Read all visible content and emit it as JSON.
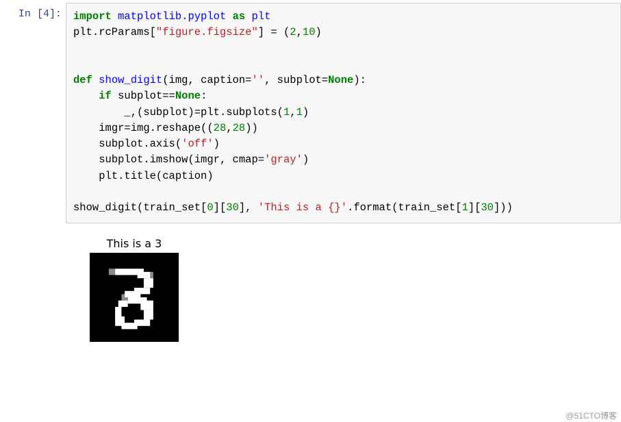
{
  "prompt": {
    "label": "In",
    "counter": "4"
  },
  "code": {
    "l1": {
      "kw1": "import",
      "mod": "matplotlib.pyplot",
      "kw2": "as",
      "alias": "plt"
    },
    "l2": {
      "pre": "plt.rcParams[",
      "str": "\"figure.figsize\"",
      "mid": "] = (",
      "n1": "2",
      "c1": ",",
      "n2": "10",
      "post": ")"
    },
    "l5": {
      "kw": "def",
      "fn": "show_digit",
      "sig1": "(img, caption=",
      "s_empty": "''",
      "sig2": ", subplot=",
      "none": "None",
      "sig3": "):"
    },
    "l6": {
      "ind": "    ",
      "kw": "if",
      "cond1": " subplot==",
      "none": "None",
      "colon": ":"
    },
    "l7": {
      "ind": "        ",
      "text1": "_,(subplot)=plt.subplots(",
      "n1": "1",
      "c": ",",
      "n2": "1",
      "close": ")"
    },
    "l8": {
      "ind": "    ",
      "text1": "imgr=img.reshape((",
      "n1": "28",
      "c": ",",
      "n2": "28",
      "close": "))"
    },
    "l9": {
      "ind": "    ",
      "text1": "subplot.axis(",
      "s": "'off'",
      "close": ")"
    },
    "l10": {
      "ind": "    ",
      "text1": "subplot.imshow(imgr, cmap=",
      "s": "'gray'",
      "close": ")"
    },
    "l11": {
      "ind": "    ",
      "text1": "plt.title(caption)"
    },
    "l13": {
      "text1": "show_digit(train_set[",
      "n1": "0",
      "b1": "][",
      "n2": "30",
      "b2": "], ",
      "s": "'This is a {}'",
      "text2": ".format(train_set[",
      "n3": "1",
      "b3": "][",
      "n4": "30",
      "b4": "]))"
    }
  },
  "output": {
    "title": "This is a 3"
  },
  "watermark": "@51CTO博客",
  "digit_svg": {
    "bg": "#000000",
    "fg": "#ffffff",
    "mid": "#888888"
  }
}
